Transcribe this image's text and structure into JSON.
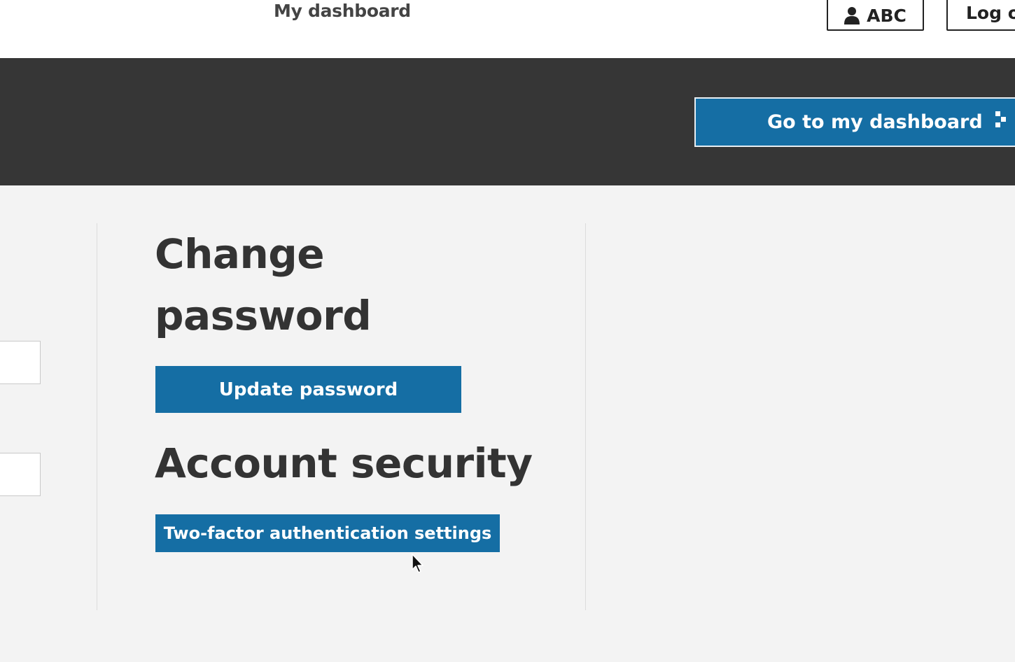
{
  "header": {
    "nav_link": "My dashboard",
    "user_label": "ABC",
    "logout_label": "Log out"
  },
  "banner": {
    "dashboard_button": "Go to my dashboard"
  },
  "main": {
    "change_password_heading_line1": "Change",
    "change_password_heading_line2": "password",
    "update_password_button": "Update password",
    "account_security_heading": "Account security",
    "two_factor_button": "Two-factor authentication settings"
  },
  "icons": {
    "user": "user-icon",
    "dashboard": "arrow-icon",
    "cursor": "mouse-pointer"
  },
  "colors": {
    "primary": "#156ea4",
    "banner": "#363636",
    "background": "#f3f3f3"
  }
}
